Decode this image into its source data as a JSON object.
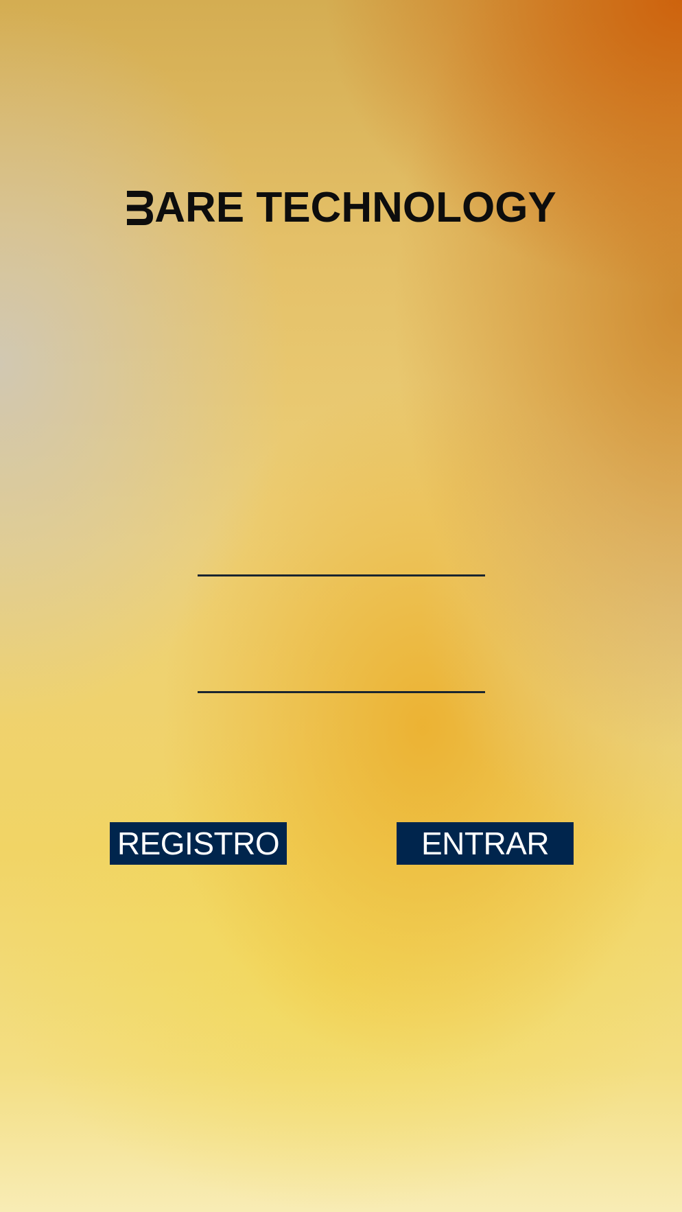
{
  "app": {
    "logo_text": "ARE TECHNOLOGY",
    "logo_mark_icon": "reversed-b-logo-icon"
  },
  "login_form": {
    "username_value": "",
    "password_value": ""
  },
  "actions": {
    "register_label": "REGISTRO",
    "login_label": "ENTRAR"
  },
  "colors": {
    "button_background": "#00254d",
    "button_text": "#ffffff",
    "logo_color": "#0d0d0d",
    "field_line": "#1a2530",
    "accent_orange": "#cd5f0a",
    "accent_yellow": "#f1d465"
  }
}
